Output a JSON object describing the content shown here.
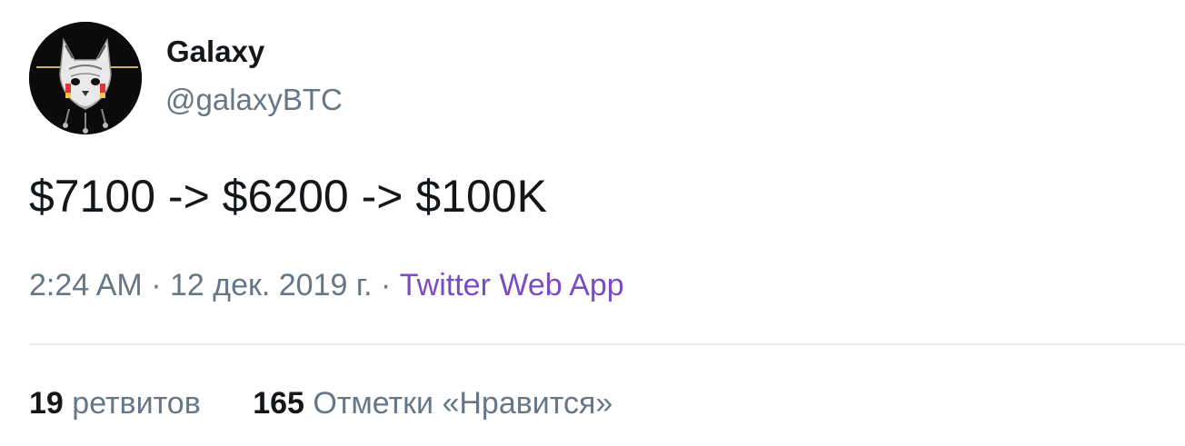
{
  "author": {
    "name": "Galaxy",
    "handle": "@galaxyBTC"
  },
  "tweet": {
    "text": "$7100 -> $6200 -> $100K",
    "time": "2:24 AM",
    "date": "12 дек. 2019 г.",
    "separator": "·",
    "source": "Twitter Web App"
  },
  "stats": {
    "retweets_count": "19",
    "retweets_label": "ретвитов",
    "likes_count": "165",
    "likes_label": "Отметки «Нравится»"
  },
  "colors": {
    "text_primary": "#14171a",
    "text_secondary": "#657786",
    "source_link": "#794bc4",
    "divider": "#e6ecf0"
  },
  "icons": {
    "avatar": "cat-avatar-icon"
  }
}
